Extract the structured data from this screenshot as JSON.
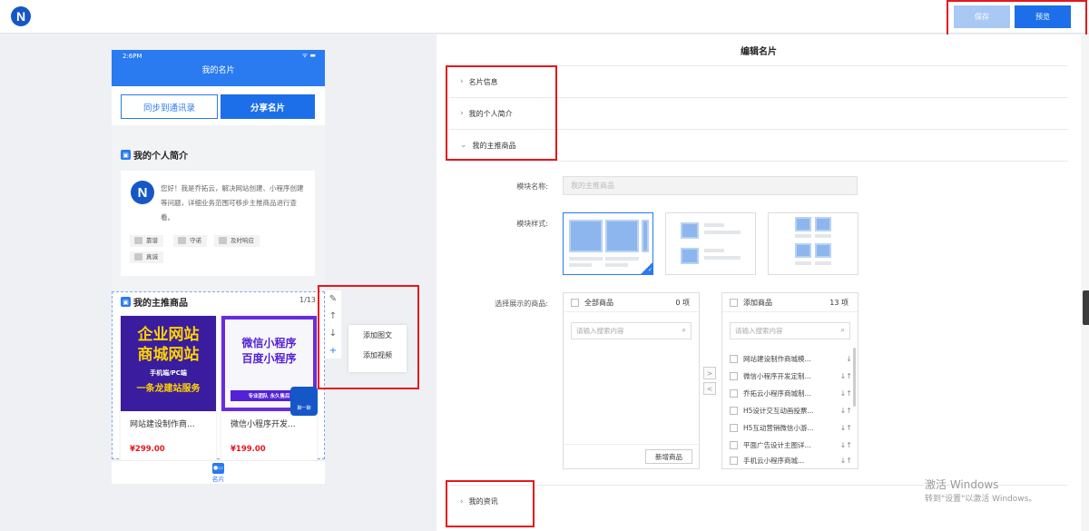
{
  "header": {
    "save_label": "保存",
    "preview_label": "预览"
  },
  "phone": {
    "time": "2:6PM",
    "signal": "ᯤ ▬",
    "title": "我的名片",
    "sync_button": "同步到通讯录",
    "share_button": "分享名片",
    "intro": {
      "title": "我的个人简介",
      "text": "您好！我是乔拓云，解决网站创建、小程序创建等问题，详细业务范围可移步主推商品进行查看。",
      "tags": [
        "靠谱",
        "守诺",
        "及时响应",
        "真诚"
      ]
    },
    "products": {
      "title": "我的主推商品",
      "count": "1/13",
      "items": [
        {
          "name": "网站建设制作商...",
          "price": "¥299.00",
          "img_line1": "企业网站",
          "img_line2": "商城网站",
          "img_line3": "手机端/PC端",
          "img_line4": "一条龙建站服务"
        },
        {
          "name": "微信小程序开发...",
          "price": "¥199.00",
          "img_line1": "微信小程序",
          "img_line2": "百度小程序",
          "img_line3": "专业团队 永久售后"
        }
      ],
      "chat_label": "聊一聊"
    },
    "tab_label": "名片",
    "tools": {
      "edit": "✎",
      "up": "↑",
      "down": "↓",
      "add": "+"
    },
    "add_menu": [
      "添加图文",
      "添加视频"
    ]
  },
  "editor": {
    "title": "编辑名片",
    "sections": [
      "名片信息",
      "我的个人简介",
      "我的主推商品",
      "我的资讯"
    ],
    "module_name_label": "模块名称:",
    "module_name_placeholder": "我的主推商品",
    "module_style_label": "模块样式:",
    "select_goods_label": "选择展示的商品:",
    "left_box": {
      "header": "全部商品",
      "count": "0 项",
      "search_placeholder": "请输入搜索内容",
      "add_button": "新增商品"
    },
    "right_box": {
      "header": "添加商品",
      "count": "13 项",
      "search_placeholder": "请输入搜索内容",
      "items": [
        "网站建设制作商城模...",
        "微信小程序开发定制...",
        "乔拓云小程序商城制...",
        "H5设计交互动画投票...",
        "H5互动营销微信小游...",
        "平面广告设计主图详...",
        "手机云小程序商城..."
      ]
    },
    "move_right": ">",
    "move_left": "<"
  },
  "watermark": {
    "line1": "激活 Windows",
    "line2": "转到\"设置\"以激活 Windows。"
  }
}
